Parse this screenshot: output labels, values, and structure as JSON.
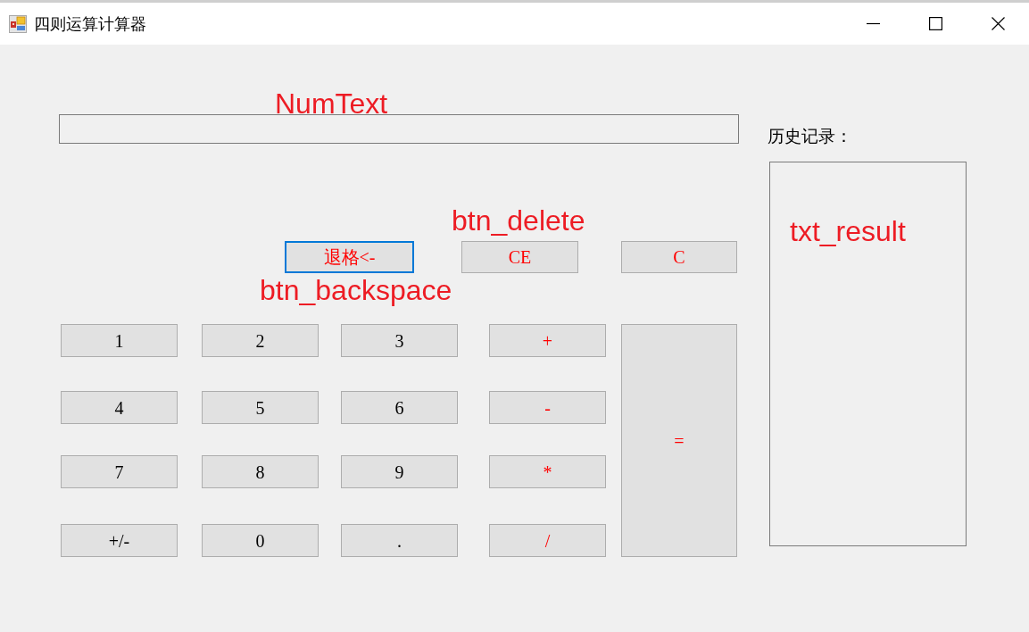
{
  "window": {
    "title": "四则运算计算器"
  },
  "num_text": {
    "annotation": "NumText"
  },
  "edit_buttons": [
    {
      "label": "退格<-",
      "kind": "operator",
      "focused": true,
      "annotation": "btn_backspace"
    },
    {
      "label": "CE",
      "kind": "operator",
      "focused": false,
      "annotation": "btn_delete"
    },
    {
      "label": "C",
      "kind": "operator",
      "focused": false
    }
  ],
  "keypad": [
    {
      "label": "1",
      "kind": "digit",
      "focused": false
    },
    {
      "label": "2",
      "kind": "digit",
      "focused": false
    },
    {
      "label": "3",
      "kind": "digit",
      "focused": false
    },
    {
      "label": "+",
      "kind": "operator",
      "focused": false
    },
    {
      "label": "4",
      "kind": "digit",
      "focused": false
    },
    {
      "label": "5",
      "kind": "digit",
      "focused": false
    },
    {
      "label": "6",
      "kind": "digit",
      "focused": false
    },
    {
      "label": "-",
      "kind": "operator",
      "focused": false
    },
    {
      "label": "7",
      "kind": "digit",
      "focused": false
    },
    {
      "label": "8",
      "kind": "digit",
      "focused": false
    },
    {
      "label": "9",
      "kind": "digit",
      "focused": false
    },
    {
      "label": "*",
      "kind": "operator",
      "focused": false
    },
    {
      "label": "+/-",
      "kind": "digit",
      "focused": false
    },
    {
      "label": "0",
      "kind": "digit",
      "focused": false
    },
    {
      "label": ".",
      "kind": "digit",
      "focused": false
    },
    {
      "label": "/",
      "kind": "operator",
      "focused": false
    }
  ],
  "equals_button": {
    "label": "=",
    "kind": "operator",
    "focused": false
  },
  "history": {
    "label": "历史记录：",
    "annotation": "txt_result"
  }
}
